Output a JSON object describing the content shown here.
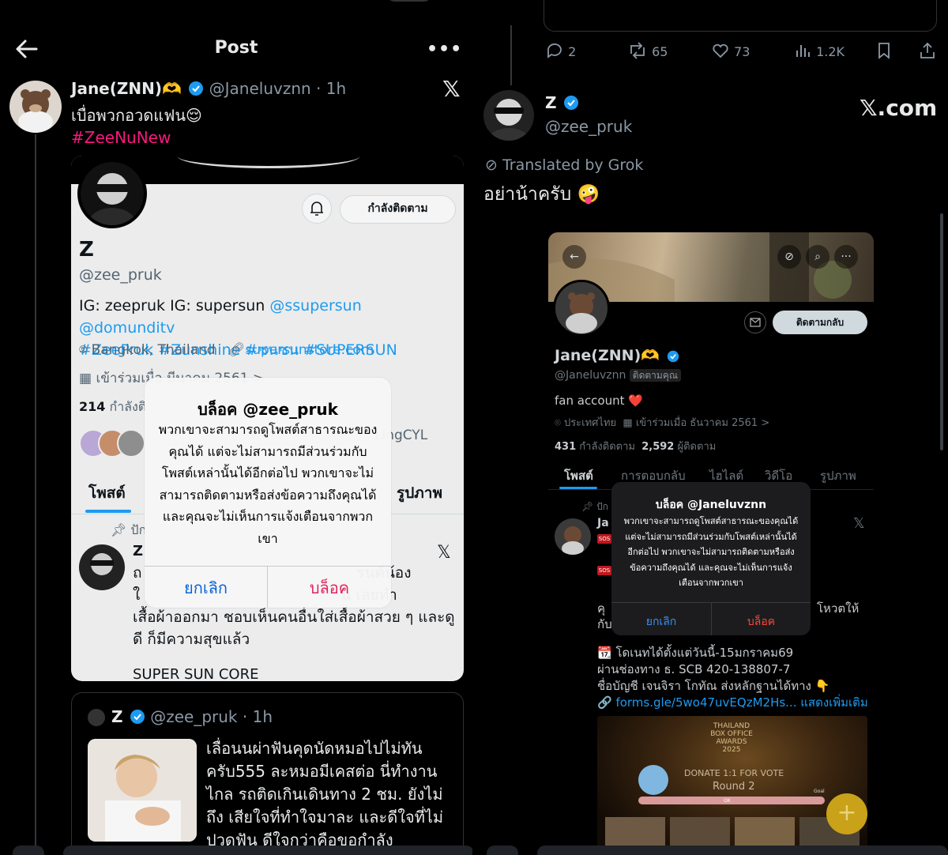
{
  "left": {
    "header": {
      "title": "Post",
      "more": "•••"
    },
    "post": {
      "author_name": "Jane(ZNN)🫶",
      "handle": "@Janeluvznn",
      "time": "· 1h",
      "x_logo": "𝕏",
      "text": "เบื่อพวกอวดแฟน😌",
      "hashtag": "#ZeeNuNew"
    },
    "screenshot": {
      "follow_label": "กำลังติดตาม",
      "name": "Z",
      "handle": "@zee_pruk",
      "bio_prefix": "IG: zeepruk IG: supersun ",
      "bio_links": "@ssupersun @domunditv",
      "bio_tags": "#ZeePruk #Zunshine #ซนซน #SUPERSUN",
      "location": "Bangkok, Thailand",
      "website": "supersunstore.com",
      "joined": "เข้าร่วมเมื่อ มีนาคม 2561 >",
      "count_num": "214",
      "count_label": "กำลังติ",
      "follower_name": "LingCYL",
      "tab_posts": "โพสต์",
      "tab_media": "รูปภาพ",
      "pinned": "ปัก",
      "post_author": "Z",
      "post_text_1": "ถ                                             รนด์น้อง",
      "post_text_2": "ใ                                          ้น เลยทำ",
      "post_text_3": "เสื้อผ้าออกมา ชอบเห็นคนอื่นใส่เสื้อผ้าสวย ๆ และดู",
      "post_text_4": "ดี ก็มีความสุขแล้ว",
      "post_tail": "SUPER SUN CORE",
      "post_x": "𝕏"
    },
    "alert": {
      "title": "บล็อค @zee_pruk",
      "message": "พวกเขาจะสามารถดูโพสต์สาธารณะของคุณได้ แต่จะไม่สามารถมีส่วนร่วมกับโพสต์เหล่านั้นได้อีกต่อไป พวกเขาจะไม่สามารถติดตามหรือส่งข้อความถึงคุณได้ และคุณจะไม่เห็นการแจ้งเตือนจากพวกเขา",
      "cancel": "ยกเลิก",
      "block": "บล็อค"
    },
    "quote": {
      "name": "Z",
      "handle": "@zee_pruk",
      "time": "· 1h",
      "text": "เลื่อนนผ่าฟันคุดนัดหมอไปไม่ทันครับ555 ละหมอมีเคสต่อ นี่ทำงานไกล รถติดเกินเดินทาง 2 ชม. ยังไม่ถึง เสียใจที่ทำใจมาละ และดีใจที่ไม่ปวดฟัน ดีใจกว่าคือขอกำลัง"
    }
  },
  "right": {
    "actions": {
      "replies": "2",
      "reposts": "65",
      "likes": "73",
      "views": "1.2K"
    },
    "post": {
      "name": "Z",
      "handle": "@zee_pruk",
      "brand": "𝕏.com",
      "translated": "Translated by Grok",
      "text": "อย่าน้าครับ 🤪"
    },
    "screenshot": {
      "follow_back": "ติดตามกลับ",
      "name": "Jane(ZNN)🫶",
      "handle": "@Janeluvznn",
      "follows_you": "ติดตามคุณ",
      "bio": "fan account ❤️",
      "location": "ประเทศไทย",
      "joined": "เข้าร่วมเมื่อ ธันวาคม 2561 >",
      "following_num": "431",
      "following_label": "กำลังติดตาม",
      "followers_num": "2,592",
      "followers_label": "ผู้ติดตาม",
      "tabs": [
        "โพสต์",
        "การตอบกลับ",
        "ไฮไลต์",
        "วิดีโอ",
        "รูปภาพ"
      ],
      "pinned": "ปัก",
      "post_author": "Ja",
      "sos": "SOS",
      "x_logo": "𝕏",
      "tail_1": "คุ",
      "tail_2": "กับ",
      "tail_right": "โหวตให้",
      "body_1": "📆 โดเนทได้ตั้งแต่วันนี้-15มกราคม69",
      "body_2": "ผ่านช่องทาง ธ. SCB  420-138807-7",
      "body_3": "ชื่อบัญชี เจนจิรา โกทัณ ส่งหลักฐานได้ทาง 👇",
      "link": "🔗 forms.gle/5wo47uvEQzM2Hs...",
      "more": "แสดงเพิ่มเติม",
      "poster_title": "THAILAND BOX OFFICE AWARDS 2025",
      "poster_donate": "DONATE 1:1 FOR VOTE",
      "poster_round": "Round 2",
      "poster_goal": "Goal",
      "poster_ok": "OK"
    },
    "alert": {
      "title": "บล็อค @Janeluvznn",
      "message": "พวกเขาจะสามารถดูโพสต์สาธารณะของคุณได้ แต่จะไม่สามารถมีส่วนร่วมกับโพสต์เหล่านั้นได้อีกต่อไป พวกเขาจะไม่สามารถติดตามหรือส่งข้อความถึงคุณได้ และคุณจะไม่เห็นการแจ้งเตือนจากพวกเขา",
      "cancel": "ยกเลิก",
      "block": "บล็อค"
    },
    "fab": "+"
  },
  "colors": {
    "accent": "#1d9bf0",
    "hashtag": "#f91880",
    "danger": "#e0245e",
    "fab": "#c9a21a"
  },
  "icons": [
    "back-arrow-icon",
    "more-icon",
    "verified-icon",
    "x-logo-icon",
    "bell-icon",
    "location-icon",
    "link-icon",
    "calendar-icon",
    "pin-icon",
    "reply-icon",
    "repost-icon",
    "like-icon",
    "views-icon",
    "bookmark-icon",
    "share-icon",
    "translate-icon",
    "mail-icon",
    "search-icon",
    "plus-icon"
  ]
}
